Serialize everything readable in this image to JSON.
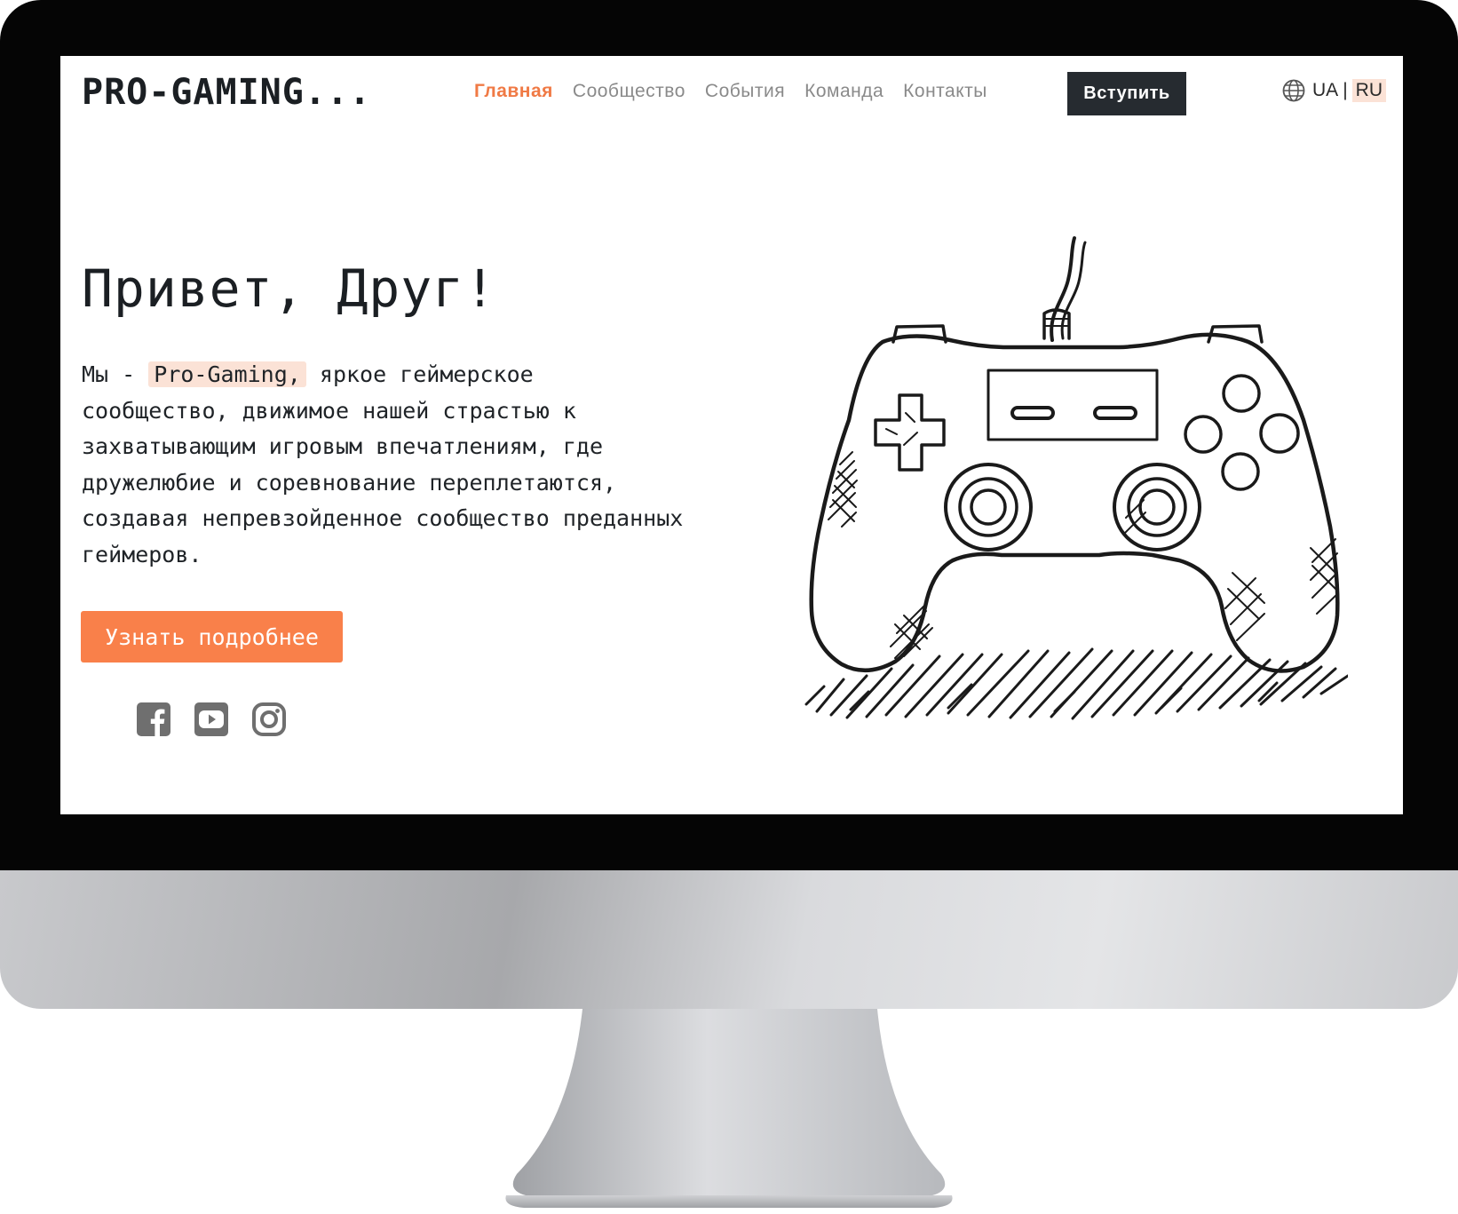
{
  "header": {
    "logo": "PRO-GAMING...",
    "nav": [
      {
        "label": "Главная",
        "active": true
      },
      {
        "label": "Сообщество",
        "active": false
      },
      {
        "label": "События",
        "active": false
      },
      {
        "label": "Команда",
        "active": false
      },
      {
        "label": "Контакты",
        "active": false
      }
    ],
    "join_label": "Вступить",
    "lang": {
      "icon": "globe-icon",
      "options": [
        "UA",
        "RU"
      ],
      "separator": "|",
      "current": "RU"
    }
  },
  "hero": {
    "title": "Привет, Друг!",
    "text_before": "Мы - ",
    "highlight": "Pro-Gaming,",
    "text_after": " яркое геймерское сообщество, движимое нашей страстью к захватывающим игровым впечатлениям, где дружелюбие и соревнование переплетаются, создавая непревзойденное сообщество преданных геймеров.",
    "cta_label": "Узнать подробнее",
    "socials": [
      "facebook-icon",
      "youtube-icon",
      "instagram-icon"
    ],
    "illustration": "gamepad-illustration"
  },
  "colors": {
    "accent": "#f9804a",
    "nav_active": "#f07a45",
    "highlight_bg": "#fbe2d6",
    "dark_button": "#262b30",
    "text": "#1b1f23"
  }
}
